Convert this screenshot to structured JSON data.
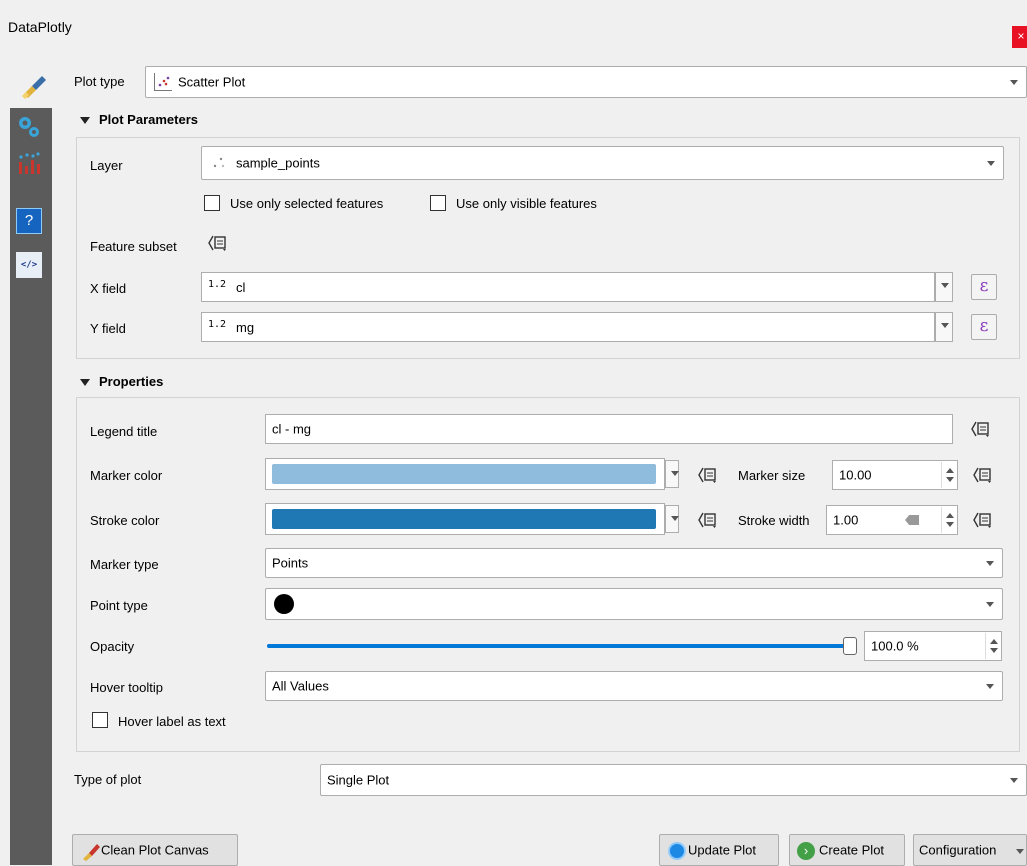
{
  "window": {
    "title": "DataPlotly",
    "close_label": "×"
  },
  "plot_type": {
    "label": "Plot type",
    "value": "Scatter Plot",
    "icon": "scatter-plot-icon"
  },
  "sidebar": {
    "items": [
      {
        "name": "brush-icon"
      },
      {
        "name": "gears-icon"
      },
      {
        "name": "plot-icon"
      },
      {
        "name": "help-icon",
        "glyph": "?"
      },
      {
        "name": "code-icon",
        "glyph": "</>"
      }
    ]
  },
  "plot_parameters": {
    "header": "Plot Parameters",
    "layer_label": "Layer",
    "layer_value": "sample_points",
    "use_selected_label": "Use only selected features",
    "use_visible_label": "Use only visible features",
    "feature_subset_label": "Feature subset",
    "x_field_label": "X field",
    "x_field_type": "1.2",
    "x_field_value": "cl",
    "y_field_label": "Y field",
    "y_field_type": "1.2",
    "y_field_value": "mg",
    "epsilon": "ε"
  },
  "properties": {
    "header": "Properties",
    "legend_title_label": "Legend title",
    "legend_title_value": "cl - mg",
    "marker_color_label": "Marker color",
    "marker_color": "#8fbcdc",
    "marker_size_label": "Marker size",
    "marker_size_value": "10.00",
    "stroke_color_label": "Stroke color",
    "stroke_color": "#1f77b4",
    "stroke_width_label": "Stroke width",
    "stroke_width_value": "1.00",
    "marker_type_label": "Marker type",
    "marker_type_value": "Points",
    "point_type_label": "Point type",
    "opacity_label": "Opacity",
    "opacity_fraction": 1.0,
    "opacity_value": "100.0 %",
    "hover_tooltip_label": "Hover tooltip",
    "hover_tooltip_value": "All Values",
    "hover_label_text": "Hover label as text"
  },
  "type_of_plot": {
    "label": "Type of plot",
    "value": "Single Plot"
  },
  "buttons": {
    "clean": "Clean Plot Canvas",
    "update": "Update Plot",
    "create": "Create Plot",
    "configuration": "Configuration"
  },
  "colors": {
    "accent": "#0078d7",
    "epsilon": "#8a3ab9",
    "close": "#e81123",
    "sidebar": "#5b5b5b"
  }
}
